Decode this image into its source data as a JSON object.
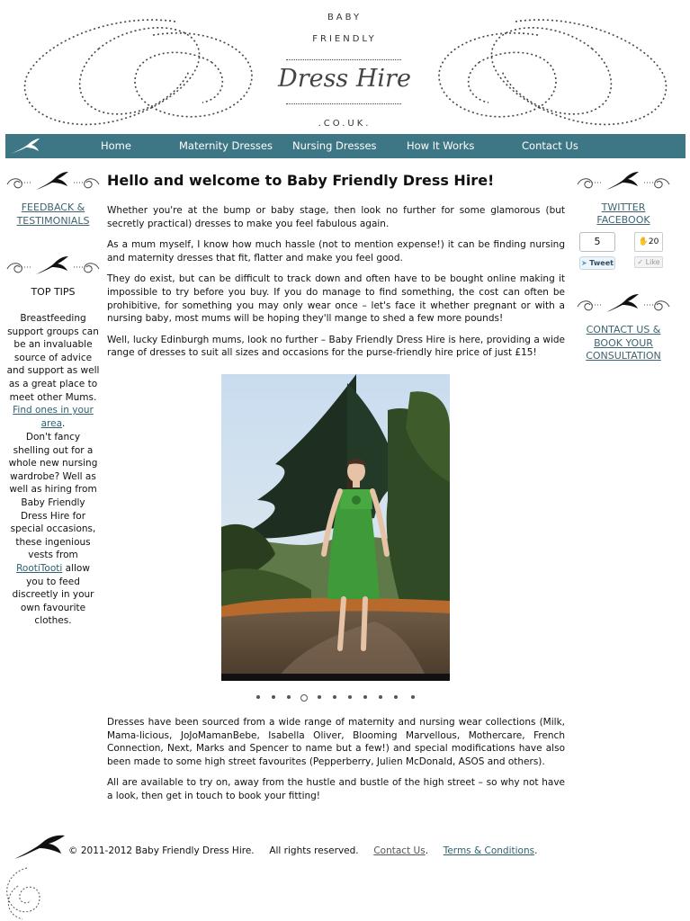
{
  "header": {
    "logo_line1": "BABY",
    "logo_line2": "FRIENDLY",
    "logo_main": "Dress Hire",
    "logo_domain": ".CO.UK."
  },
  "nav": {
    "items": [
      {
        "label": "Home"
      },
      {
        "label": "Maternity Dresses"
      },
      {
        "label": "Nursing Dresses"
      },
      {
        "label": "How It Works"
      },
      {
        "label": "Contact Us"
      }
    ]
  },
  "left_sidebar": {
    "feedback_line1": "FEEDBACK &",
    "feedback_line2": "TESTIMONIALS",
    "tips_title": "TOP TIPS",
    "tip1_text": "Breastfeeding support groups can be an invaluable source of advice and support as well as a great place to meet other Mums.",
    "tip1_link": "Find ones in your area",
    "tip2_text": "Don't fancy shelling out for a whole new nursing wardrobe? Well as well as hiring from Baby Friendly Dress Hire for special occasions, these ingenious vests from",
    "tip2_link": "RootiTooti",
    "tip2_text2": "allow you to feed discreetly in your own favourite clothes."
  },
  "right_sidebar": {
    "twitter": "TWITTER",
    "facebook": "FACEBOOK",
    "tweet_count": "5",
    "tweet_label": "Tweet",
    "like_count": "20",
    "like_label": "Like",
    "contact_line1": "CONTACT US &",
    "contact_line2": "BOOK YOUR",
    "contact_line3": "CONSULTATION"
  },
  "main": {
    "title": "Hello and welcome to Baby Friendly Dress Hire!",
    "p1": "Whether you're at the bump or baby stage, then look no further for some glamorous (but secretly practical) dresses to make you feel fabulous again.",
    "p2": "As a mum myself, I know how much hassle (not to mention expense!) it can be finding nursing and maternity dresses that fit, flatter and make you feel good.",
    "p3": "They do exist, but can be difficult to track down and often have to be bought online making it impossible to try before you buy. If you do manage to find something, the cost can often be prohibitive, for something you may only wear once – let's face it whether pregnant or with a nursing baby, most mums will be hoping they'll mange to shed a few more pounds!",
    "p4": "Well, lucky Edinburgh mums, look no further – Baby Friendly Dress Hire is here, providing a wide range of dresses to suit all sizes and occasions for the purse-friendly hire price of just £15!",
    "p5": "Dresses have been sourced from a wide range of maternity and nursing wear collections (Milk, Mama-licious, JoJoMamanBebe, Isabella Oliver, Blooming Marvellous, Mothercare, French Connection, Next, Marks and Spencer to name but a few!) and special modifications have also been made to some high street favourites (Pepperberry, Julien McDonald, ASOS and others).",
    "p6": "All are available to try on, away from the hustle and bustle of the high street – so why not have a look, then get in touch to book your fitting!"
  },
  "slideshow": {
    "slide_count": 11,
    "active_slide": 4
  },
  "footer": {
    "copyright": "© 2011-2012 Baby Friendly Dress Hire.",
    "rights": "All rights reserved.",
    "contact_link": "Contact Us",
    "terms_link": "Terms & Conditions"
  },
  "colors": {
    "nav_bg": "#3d7684",
    "link": "#3d6470",
    "dress_green": "#3f9a3a"
  }
}
